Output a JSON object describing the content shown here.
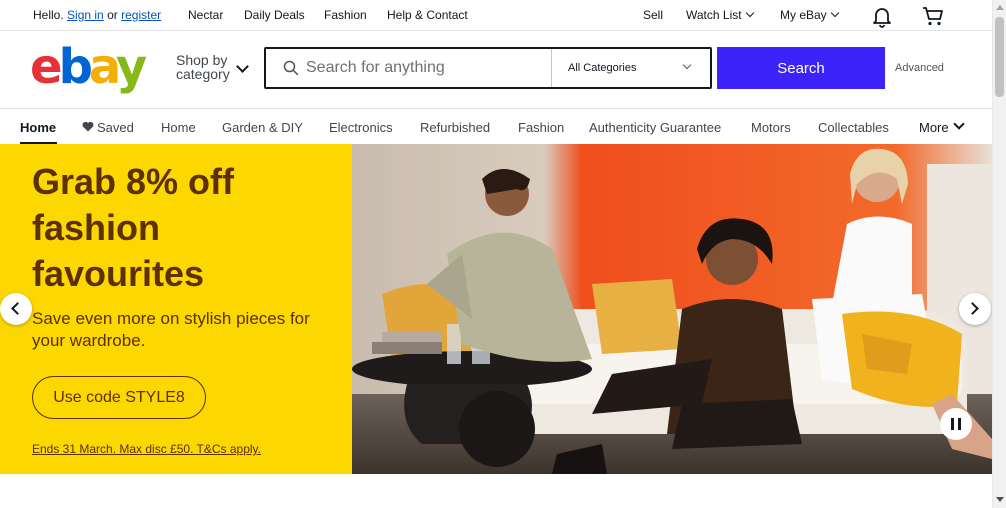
{
  "topbar": {
    "hello": "Hello.",
    "signin": "Sign in",
    "or": "or",
    "register": "register",
    "links": [
      "Nectar",
      "Daily Deals",
      "Fashion",
      "Help & Contact"
    ],
    "sell": "Sell",
    "watchlist": "Watch List",
    "myebay": "My eBay",
    "icons": [
      "bell-icon",
      "cart-icon"
    ]
  },
  "header": {
    "logo": {
      "e": "e",
      "b": "b",
      "a": "a",
      "y": "y"
    },
    "shop_by_line1": "Shop by",
    "shop_by_line2": "category",
    "search_placeholder": "Search for anything",
    "category_selected": "All Categories",
    "search_button": "Search",
    "advanced": "Advanced"
  },
  "nav": {
    "active": "Home",
    "saved": "Saved",
    "items": [
      "Home",
      "Garden & DIY",
      "Electronics",
      "Refurbished",
      "Fashion",
      "Authenticity Guarantee",
      "Motors",
      "Collectables"
    ],
    "more": "More"
  },
  "hero": {
    "title": "Grab 8% off fashion favourites",
    "subtitle": "Save even more on stylish pieces for your wardrobe.",
    "cta": "Use code STYLE8",
    "terms": "Ends 31 March. Max disc £50. T&Cs apply."
  },
  "colors": {
    "search_button": "#3b23fa",
    "promo_bg": "#fcd700",
    "promo_text": "#5c3000",
    "link": "#0654ba"
  }
}
